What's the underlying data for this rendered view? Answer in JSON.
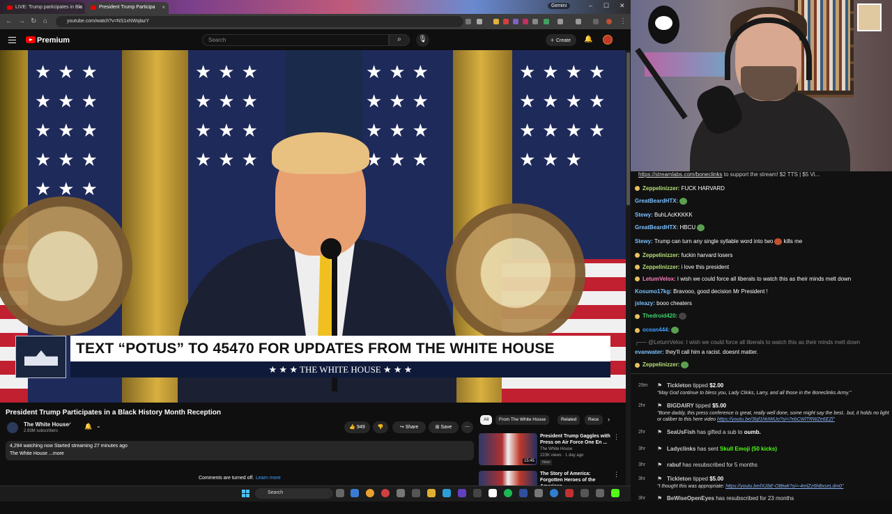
{
  "browser": {
    "tabs": [
      {
        "label": "LIVE: Trump participates in Bla"
      },
      {
        "label": "President Trump Participa"
      }
    ],
    "gemini_label": "Gemini",
    "url": "youtube.com/watch?v=NS1xNWqlazY"
  },
  "yt_header": {
    "brand": "Premium",
    "search_placeholder": "Search",
    "create_label": "Create"
  },
  "video": {
    "lower_third_text": "TEXT “POTUS” TO 45470 FOR UPDATES FROM THE WHITE HOUSE",
    "lower_third_sub": "★ ★ ★   THE WHITE HOUSE   ★ ★ ★"
  },
  "below_video": {
    "title": "President Trump Participates in a Black History Month Reception",
    "channel": "The White House",
    "subscribers": "2.93M subscribers",
    "likes": "949",
    "share_label": "Share",
    "save_label": "Save",
    "desc_line1": "4,294 watching now  Started streaming 27 minutes ago",
    "desc_line2": "The White House ...more",
    "comments_off": "Comments are turned off.",
    "learn_more": "Learn more",
    "chips": [
      "All",
      "From The White House",
      "Related",
      "Rece"
    ],
    "recommended": [
      {
        "title": "President Trump Gaggles with Press on Air Force One En ...",
        "channel": "The White House",
        "views": "223K views · 1 day ago",
        "badge": "New",
        "duration": "15:45"
      },
      {
        "title": "The Story of America: Forgotten Heroes of the American ...",
        "channel": "",
        "views": "",
        "badge": "",
        "duration": ""
      }
    ]
  },
  "taskbar": {
    "search_label": "Search"
  },
  "chat": {
    "promo_link": "https://streamlabs.com/boneclinks",
    "promo_rest": " to support the stream! $2 TTS | $5 Vi...",
    "messages": [
      {
        "user": "Zeppelinizzer:",
        "text": " FUCK HARVARD",
        "color": "#b8e07a",
        "badge": true
      },
      {
        "user": "GreatBeardHTX:",
        "text": "",
        "color": "#7ac0ff",
        "badge": false,
        "emote": "#5aa050"
      },
      {
        "user": "Stewy:",
        "text": " BuhLAcKKKKK",
        "color": "#7ac0ff",
        "badge": false
      },
      {
        "user": "GreatBeardHTX:",
        "text": " HBCU",
        "color": "#7ac0ff",
        "badge": false,
        "emote": "#5aa050"
      },
      {
        "user": "Stewy:",
        "text": " Trump can turn any single syllable word into two",
        "color": "#7ac0ff",
        "badge": false,
        "emote": "#c05030",
        "after": " kills me"
      },
      {
        "user": "Zeppelinizzer:",
        "text": " fuckin harvard losers",
        "color": "#b8e07a",
        "badge": true
      },
      {
        "user": "Zeppelinizzer:",
        "text": " i love this president",
        "color": "#b8e07a",
        "badge": true
      },
      {
        "user": "LetumVelox:",
        "text": " I wish we could force all liberals to watch this as their minds melt down",
        "color": "#ff80c0",
        "badge": true
      },
      {
        "user": "Kosumo17kg:",
        "text": " Bravooo, good decision Mr President !",
        "color": "#7ac0ff",
        "badge": false
      },
      {
        "user": "jsleazy:",
        "text": " booo cheaters",
        "color": "#7ac0ff",
        "badge": false
      },
      {
        "user": "Thedroid420:",
        "text": "",
        "color": "#40d070",
        "badge": true,
        "emote": "#444"
      },
      {
        "user": "ocean444:",
        "text": "",
        "color": "#40a0ff",
        "badge": true,
        "emote": "#5aa050"
      },
      {
        "user": "evanwater:",
        "text": " they'll call him a racist. doesnt matter.",
        "color": "#7ac0ff",
        "badge": false
      },
      {
        "user": "Zeppelinizzer:",
        "text": "",
        "color": "#b8e07a",
        "badge": true,
        "emote": "#5aa050"
      }
    ],
    "reply_line": "@LetumVelox: I wish we could force all liberals to watch this as their minds melt down"
  },
  "events": [
    {
      "time": "29m",
      "text_user": "Tickleton",
      "text": " tipped ",
      "amount": "$2.00",
      "quote": "\"May God continue to bless you, Lady Clinks, Larry, and all those in the Boneclinks Army.\""
    },
    {
      "time": "2hr",
      "text_user": "BIGDAIRY",
      "text": " tipped ",
      "amount": "$5.00",
      "quote": "\"Bone daddy, this press conference is great, really well done, some might say the best.. but, it holds no light or caliber to this here video ",
      "quote_link": "https://youtu.be/3lqf1hkIWUo?si=7ebCWlTRWZe6EZl\""
    },
    {
      "time": "2hr",
      "text_user": "SeaUsFish",
      "text": " has gifted a sub to ",
      "amount": "oumb."
    },
    {
      "time": "3hr",
      "text_user": "Ladyclinks",
      "text": " has sent ",
      "amount": "Skull Emoji (50 kicks)"
    },
    {
      "time": "3hr",
      "text_user": "rabuf",
      "text": " has resubscribed for 5 months",
      "amount": ""
    },
    {
      "time": "3hr",
      "text_user": "Tickleton",
      "text": " tipped ",
      "amount": "$5.00",
      "quote": "\"I thought this was appropriate: ",
      "quote_link": "https://youtu.be/lX2bE-OBtwk?si=-4mlZz6hBxseLdm0\""
    },
    {
      "time": "3hr",
      "text_user": "BeWiseOpenEyes",
      "text": " has resubscribed for 23 months",
      "amount": ""
    }
  ]
}
